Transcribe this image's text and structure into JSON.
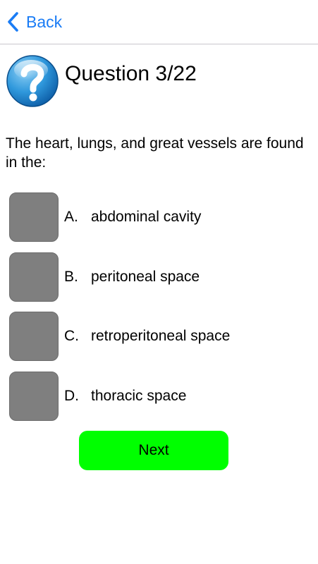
{
  "nav": {
    "back_label": "Back"
  },
  "question": {
    "title": "Question 3/22",
    "text": "The heart, lungs, and great vessels are found in the:"
  },
  "options": [
    {
      "letter": "A.",
      "text": "abdominal cavity"
    },
    {
      "letter": "B.",
      "text": "peritoneal space"
    },
    {
      "letter": "C.",
      "text": "retroperitoneal space"
    },
    {
      "letter": "D.",
      "text": "thoracic space"
    }
  ],
  "actions": {
    "next_label": "Next"
  },
  "colors": {
    "accent": "#1a7cf5",
    "option_box": "#7f7f7f",
    "next_button": "#00ff00"
  },
  "icons": {
    "back": "chevron-left-icon",
    "question": "question-mark-icon"
  }
}
